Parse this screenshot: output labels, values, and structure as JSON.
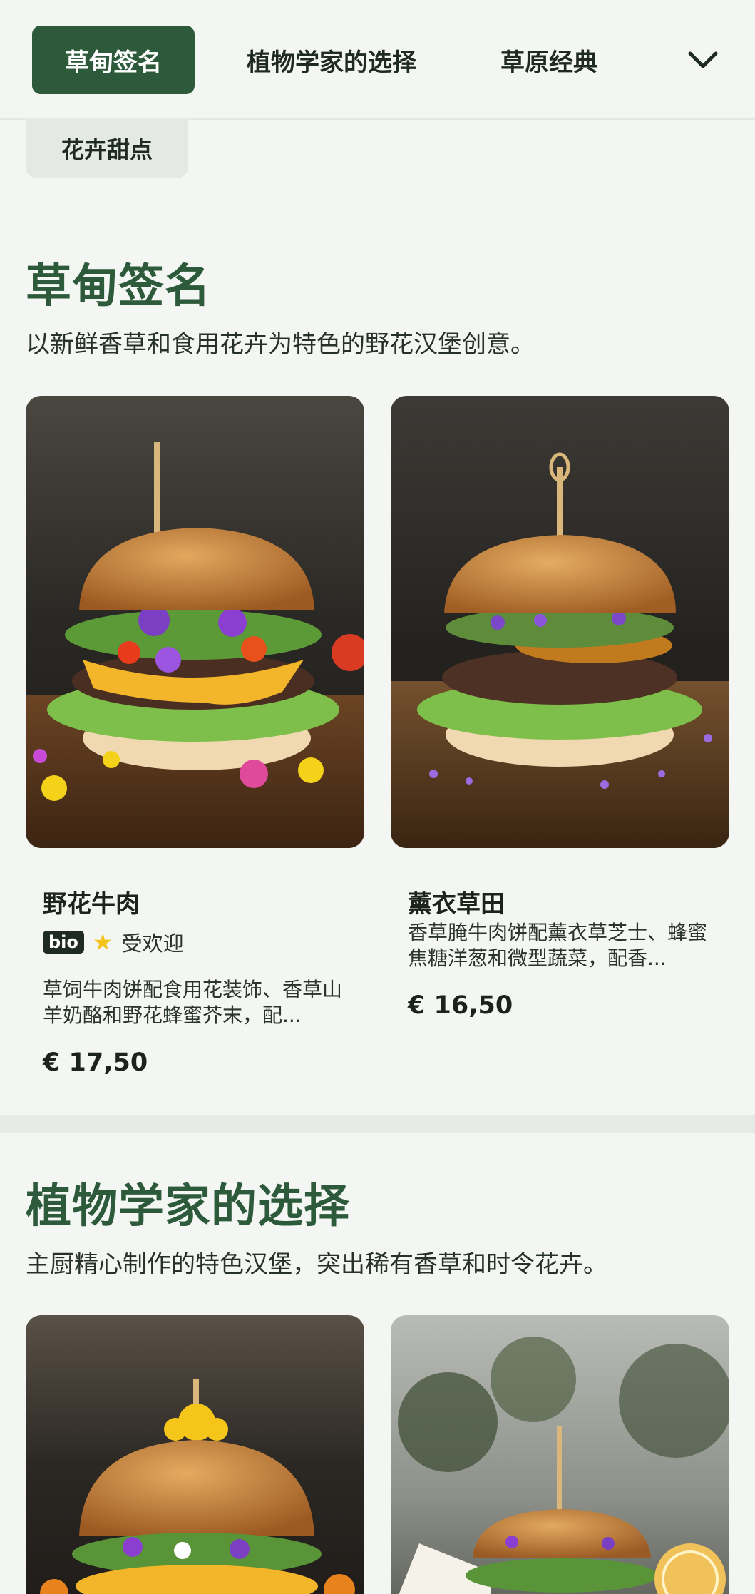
{
  "nav": {
    "tabs": [
      {
        "label": "草甸签名",
        "active": true
      },
      {
        "label": "植物学家的选择",
        "active": false
      },
      {
        "label": "草原经典",
        "active": false
      }
    ],
    "overflow_chip": "花卉甜点",
    "expand_icon": "chevron-down-icon"
  },
  "colors": {
    "brand_green": "#2d5a3a",
    "background": "#f3f6f3",
    "star": "#f2c31b"
  },
  "sections": [
    {
      "title": "草甸签名",
      "description": "以新鲜香草和食用花卉为特色的野花汉堡创意。",
      "items": [
        {
          "name": "野花牛肉",
          "badge": "bio",
          "popular_label": "受欢迎",
          "description": "草饲牛肉饼配食用花装饰、香草山羊奶酪和野花蜂蜜芥末，配...",
          "price": "€ 17,50"
        },
        {
          "name": "薰衣草田",
          "description": "香草腌牛肉饼配薰衣草芝士、蜂蜜焦糖洋葱和微型蔬菜，配香...",
          "price": "€ 16,50"
        }
      ]
    },
    {
      "title": "植物学家的选择",
      "description": "主厨精心制作的特色汉堡，突出稀有香草和时令花卉。"
    }
  ]
}
